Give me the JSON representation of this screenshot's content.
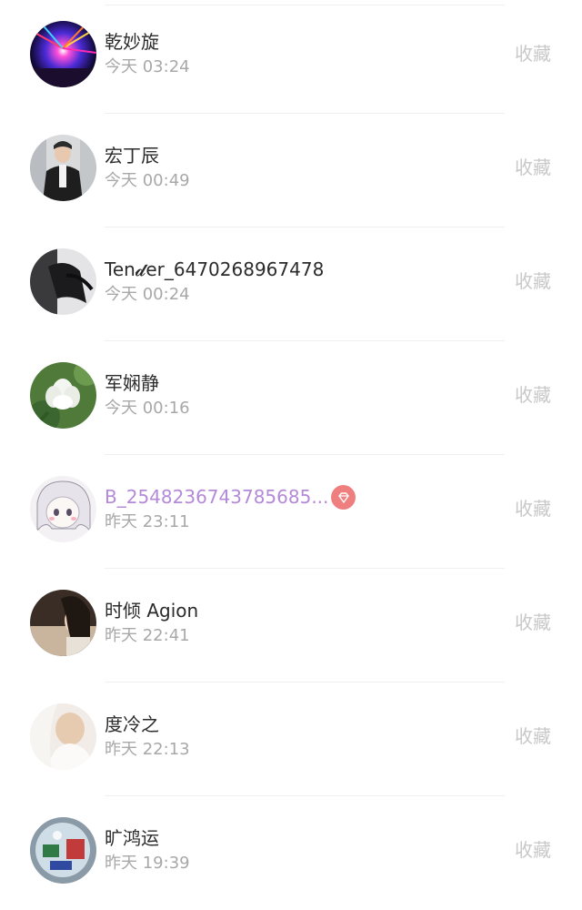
{
  "favorites_label": "收藏",
  "users": [
    {
      "name": "乾妙旋",
      "time": "今天 03:24",
      "vip": false,
      "avatar_icon": "concert-lights-avatar"
    },
    {
      "name": "宏丁辰",
      "time": "今天 00:49",
      "vip": false,
      "avatar_icon": "man-portrait-avatar"
    },
    {
      "name": "Ten𝓭er_6470268967478",
      "time": "今天 00:24",
      "vip": false,
      "avatar_icon": "dark-figure-avatar"
    },
    {
      "name": "军娴静",
      "time": "今天 00:16",
      "vip": false,
      "avatar_icon": "white-flower-avatar"
    },
    {
      "name": "B_2548236743785685...",
      "time": "昨天 23:11",
      "vip": true,
      "avatar_icon": "anime-girl-avatar"
    },
    {
      "name": "时倾 Agion",
      "time": "昨天 22:41",
      "vip": false,
      "avatar_icon": "girl-portrait-avatar"
    },
    {
      "name": "度冷之",
      "time": "昨天 22:13",
      "vip": false,
      "avatar_icon": "blurred-portrait-avatar"
    },
    {
      "name": "旷鸿运",
      "time": "昨天 19:39",
      "vip": false,
      "avatar_icon": "glass-ball-avatar"
    }
  ],
  "colors": {
    "name": "#2b2b2b",
    "vip_name": "#b48ad8",
    "time": "#a8a8a8",
    "favorite": "#c8c8c8",
    "vip_badge": "#ef7f7f"
  }
}
